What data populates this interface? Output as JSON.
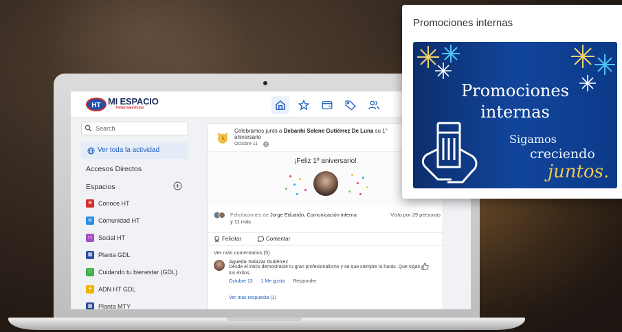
{
  "app": {
    "logo_badge": "HT",
    "logo_title": "MI ESPACIO",
    "logo_sub": "HellermannTyton"
  },
  "nav": {
    "icons": [
      "home-icon",
      "star-icon",
      "wallet-icon",
      "tag-icon",
      "people-icon"
    ],
    "active": "home-icon"
  },
  "sidebar": {
    "search_placeholder": "Search",
    "activity_link": "Ver toda la actividad",
    "quick_access": "Accesos Directos",
    "spaces_title": "Espacios",
    "spaces": [
      {
        "label": "Conoce HT",
        "color": "#d62f2f"
      },
      {
        "label": "Comunidad HT",
        "color": "#2e8ae6"
      },
      {
        "label": "Social HT",
        "color": "#a64dc7"
      },
      {
        "label": "Planta GDL",
        "color": "#2f4f9e"
      },
      {
        "label": "Cuidando tu bienestar (GDL)",
        "color": "#43b04a"
      },
      {
        "label": "ADN HT GDL",
        "color": "#f0b400"
      },
      {
        "label": "Planta MTY",
        "color": "#2f4f9e"
      }
    ]
  },
  "post": {
    "text_pre": "Celebramos junto a ",
    "text_name": "Debanhi Selene Gutiérrez De Luna",
    "text_post": " su 1° aniversario",
    "date": "Octubre 11",
    "celebration_title": "¡Feliz 1º aniversario!",
    "likes_prefix": "Felicitaciones de ",
    "likes_names": "Jorge Eduardo, Comunicación interna",
    "likes_more": "y 11 más",
    "seen_by": "Visto por 29 personas",
    "action_congratulate": "Felicitar",
    "action_comment": "Comentar",
    "more_comments": "Ver más comentarios (5)",
    "comment": {
      "author": "Agueda Salazar Gutiérrez",
      "body": "Desde el inicio demostraste tu gran profesionalismo y se que siempre lo harás. Que sigan tus éxitos.",
      "date": "Octubre 13",
      "likes": "1 Me gusta",
      "reply": "Responder"
    },
    "more_replies": "Ver más respuesta (1)"
  },
  "promo": {
    "title": "Promociones internas",
    "banner_line1": "Promociones",
    "banner_line2": "internas",
    "banner_sub1": "Sigamos",
    "banner_sub2": "creciendo",
    "banner_script": "juntos."
  }
}
